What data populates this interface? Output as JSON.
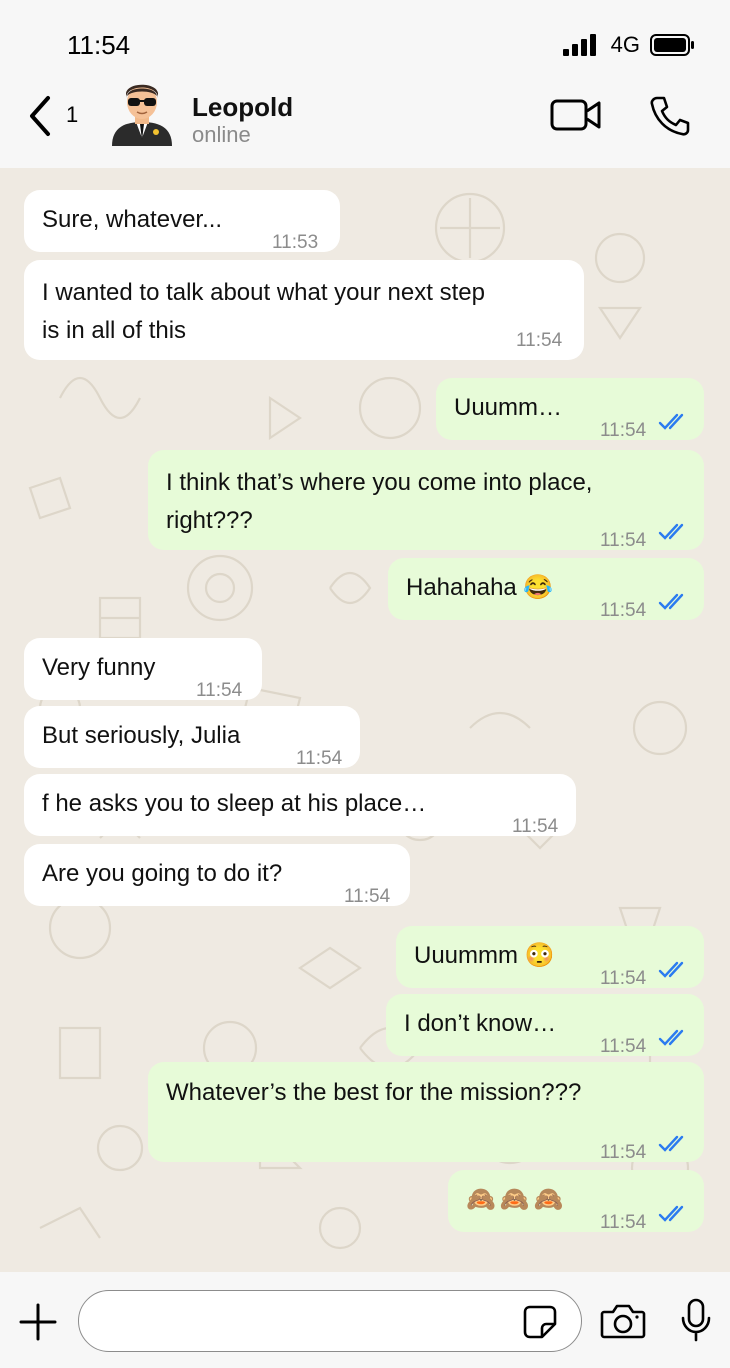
{
  "status_bar": {
    "time": "11:54",
    "network": "4G"
  },
  "header": {
    "back_count": "1",
    "contact_name": "Leopold",
    "status": "online"
  },
  "messages": [
    {
      "dir": "in",
      "text": "Sure, whatever...",
      "time": "11:53"
    },
    {
      "dir": "in",
      "text": "I wanted to talk about what your next step is in all of this",
      "line1": "I wanted to talk about what your next step",
      "line2": "is in all of this",
      "time": "11:54"
    },
    {
      "dir": "out",
      "text": "Uuumm…",
      "time": "11:54"
    },
    {
      "dir": "out",
      "text": "I think that’s where you come into place, right???",
      "line1": "I think that’s where you come into place,",
      "line2": "right???",
      "time": "11:54"
    },
    {
      "dir": "out",
      "text": "Hahahaha 😂",
      "time": "11:54"
    },
    {
      "dir": "in",
      "text": "Very funny",
      "time": "11:54"
    },
    {
      "dir": "in",
      "text": "But seriously, Julia",
      "time": "11:54"
    },
    {
      "dir": "in",
      "text": "f he asks you to sleep at his place…",
      "time": "11:54"
    },
    {
      "dir": "in",
      "text": "Are you going to do it?",
      "time": "11:54"
    },
    {
      "dir": "out",
      "text": "Uuummm 😳",
      "time": "11:54"
    },
    {
      "dir": "out",
      "text": "I don’t know…",
      "time": "11:54"
    },
    {
      "dir": "out",
      "text": "Whatever’s the best for the mission???",
      "time": "11:54"
    },
    {
      "dir": "out",
      "text": "🙈🙈🙈",
      "time": "11:54"
    }
  ],
  "colors": {
    "incoming": "#ffffff",
    "outgoing": "#e7fbd8",
    "chat_bg": "#efeae2",
    "read_ticks": "#2b7bf0"
  },
  "icons": [
    "back-chevron-icon",
    "video-call-icon",
    "voice-call-icon",
    "plus-icon",
    "sticker-icon",
    "camera-icon",
    "microphone-icon"
  ]
}
